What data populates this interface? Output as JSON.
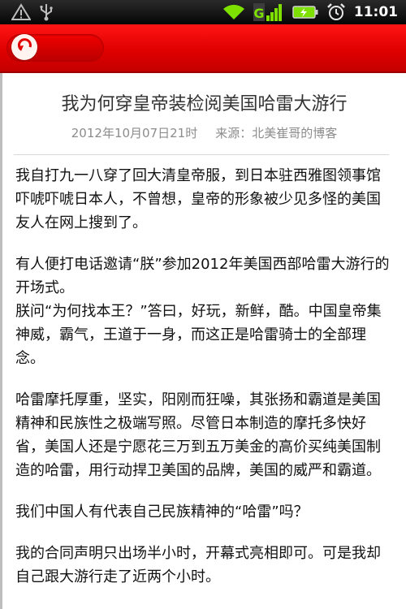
{
  "status_bar": {
    "time": "11:01",
    "network_label": "G",
    "icons": [
      "warning-icon",
      "usb-icon",
      "wifi-icon",
      "signal-icon",
      "battery-icon",
      "alarm-icon"
    ]
  },
  "toolbar": {
    "back_icon": "back-arrow-icon",
    "color": "#e00000"
  },
  "article": {
    "title": "我为何穿皇帝装检阅美国哈雷大游行",
    "date": "2012年10月07日21时",
    "source": "来源：北美崔哥的博客",
    "paragraphs": [
      "我自打九一八穿了回大清皇帝服，到日本驻西雅图领事馆吓唬吓唬日本人，不曾想，皇帝的形象被少见多怪的美国友人在网上搜到了。",
      "有人便打电话邀请“朕”参加2012年美国西部哈雷大游行的开场式。",
      "朕问“为何找本王？”答曰，好玩，新鲜，酷。中国皇帝集神威，霸气，王道于一身，而这正是哈雷骑士的全部理念。",
      "哈雷摩托厚重，坚实，阳刚而狂噪，其张扬和霸道是美国精神和民族性之极端写照。尽管日本制造的摩托多快好省，美国人还是宁愿花三万到五万美金的高价买纯美国制造的哈雷，用行动捍卫美国的品牌，美国的威严和霸道。",
      "我们中国人有代表自己民族精神的“哈雷”吗？",
      "我的合同声明只出场半小时，开幕式亮相即可。可是我却自己跟大游行走了近两个小时。"
    ]
  }
}
